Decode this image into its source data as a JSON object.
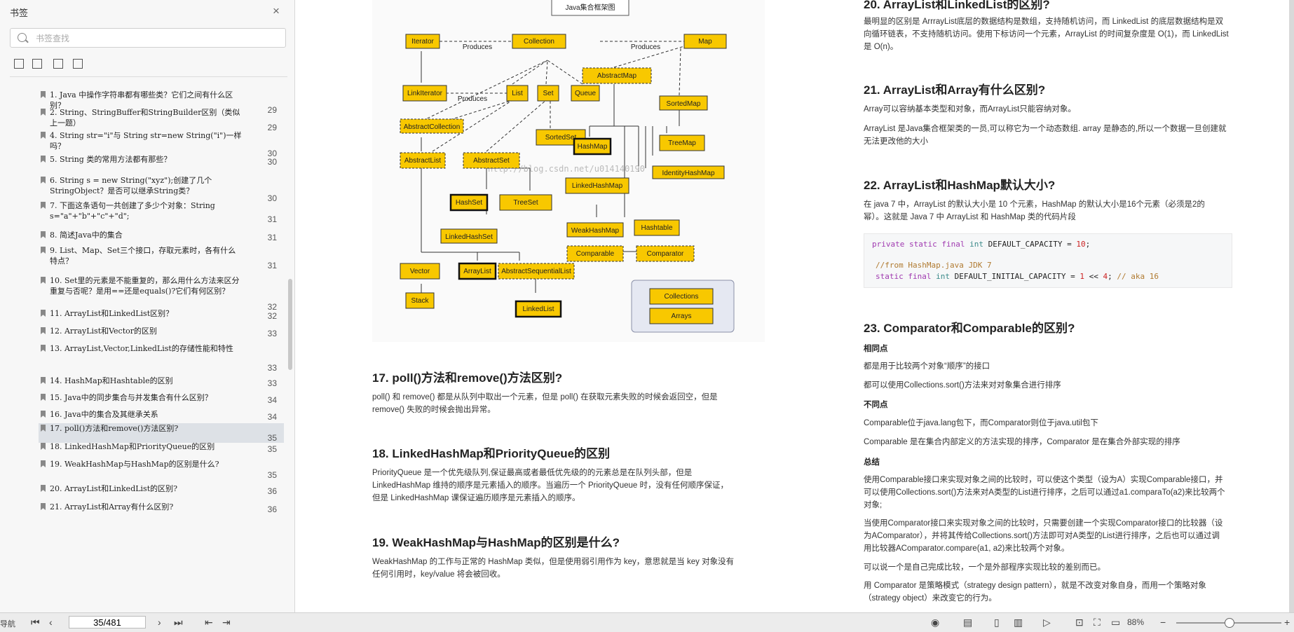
{
  "sidebar": {
    "title": "书签",
    "search_placeholder": "书签查找",
    "items": [
      {
        "text": "1. Java 中操作字符串都有哪些类？它们之间有什么区别？",
        "page": "29"
      },
      {
        "text": "2. String、StringBuffer和StringBuilder区别（类似上一题）",
        "page": "29"
      },
      {
        "text": "4. String str=\"i\"与 String str=new String(\"i\")一样吗？",
        "page": "30"
      },
      {
        "text": "5. String 类的常用方法都有那些？",
        "page": "30"
      },
      {
        "text": "6. String s = new String(\"xyz\");创建了几个StringObject？是否可以继承String类？",
        "page": "30"
      },
      {
        "text": "7. 下面这条语句一共创建了多少个对象：String s=\"a\"+\"b\"+\"c\"+\"d\";",
        "page": "31"
      },
      {
        "text": "8. 简述Java中的集合",
        "page": "31"
      },
      {
        "text": "9. List、Map、Set三个接口，存取元素时，各有什么特点？",
        "page": "31"
      },
      {
        "text": "10. Set里的元素是不能重复的，那么用什么方法来区分重复与否呢？是用==还是equals()?它们有何区别？",
        "page": "32"
      },
      {
        "text": "11. ArrayList和LinkedList区别？",
        "page": "32"
      },
      {
        "text": "12. ArrayList和Vector的区别",
        "page": "33"
      },
      {
        "text": "13. ArrayList,Vector,LinkedList的存储性能和特性",
        "page": "33"
      },
      {
        "text": "14. HashMap和Hashtable的区别",
        "page": "33"
      },
      {
        "text": "15. Java中的同步集合与并发集合有什么区别？",
        "page": "34"
      },
      {
        "text": "16. Java中的集合及其继承关系",
        "page": "34"
      },
      {
        "text": "17. poll()方法和remove()方法区别?",
        "page": "35"
      },
      {
        "text": "18. LinkedHashMap和PriorityQueue的区别",
        "page": "35"
      },
      {
        "text": "19. WeakHashMap与HashMap的区别是什么?",
        "page": "35"
      },
      {
        "text": "20. ArrayList和LinkedList的区别?",
        "page": "36"
      },
      {
        "text": "21. ArrayList和Array有什么区别?",
        "page": "36"
      }
    ]
  },
  "diagram": {
    "title": "Java集合框架图",
    "produces": "Produces",
    "watermark": "http://blog.csdn.net/u014140190",
    "nodes": {
      "iterator": "Iterator",
      "collection": "Collection",
      "map": "Map",
      "linkiterator": "LinkIterator",
      "list": "List",
      "set": "Set",
      "queue": "Queue",
      "abstractmap": "AbstractMap",
      "sortedmap": "SortedMap",
      "abstractcollection": "AbstractCollection",
      "sortedset": "SortedSet",
      "abstractlist": "AbstractList",
      "abstractset": "AbstractSet",
      "hashmap": "HashMap",
      "treemap": "TreeMap",
      "identityhashmap": "IdentityHashMap",
      "linkedhashmap": "LinkedHashMap",
      "hashset": "HashSet",
      "treeset": "TreeSet",
      "linkedhashset": "LinkedHashSet",
      "weakhashmap": "WeakHashMap",
      "hashtable": "Hashtable",
      "comparable": "Comparable",
      "comparator": "Comparator",
      "vector": "Vector",
      "arraylist": "ArrayList",
      "abstractsequentiallist": "AbstractSequentialList",
      "stack": "Stack",
      "linkedlist": "LinkedList",
      "collections": "Collections",
      "arrays": "Arrays"
    }
  },
  "left_col": {
    "h17": "17. poll()方法和remove()方法区别?",
    "p17": [
      "poll() 和 remove() 都是从队列中取出一个元素，但是 poll() 在获取元素失败的时候会返回空，但是",
      "remove() 失败的时候会抛出异常。"
    ],
    "h18": "18. LinkedHashMap和PriorityQueue的区别",
    "p18": [
      "PriorityQueue 是一个优先级队列,保证最高或者最低优先级的的元素总是在队列头部，但是",
      "LinkedHashMap 维持的顺序是元素插入的顺序。当遍历一个 PriorityQueue 时，没有任何顺序保证，",
      "但是 LinkedHashMap 课保证遍历顺序是元素插入的顺序。"
    ],
    "h19": "19. WeakHashMap与HashMap的区别是什么?",
    "p19": [
      "WeakHashMap 的工作与正常的 HashMap 类似，但是使用弱引用作为 key，意思就是当 key 对象没有",
      "任何引用时，key/value 将会被回收。"
    ]
  },
  "right_col": {
    "h20": "20. ArrayList和LinkedList的区别?",
    "p20": [
      "最明显的区别是 ArrrayList底层的数据结构是数组，支持随机访问，而 LinkedList 的底层数据结构是双",
      "向循环链表，不支持随机访问。使用下标访问一个元素，ArrayList 的时间复杂度是 O(1)，而 LinkedList",
      "是 O(n)。"
    ],
    "h21": "21. ArrayList和Array有什么区别?",
    "p21a": "Array可以容纳基本类型和对象，而ArrayList只能容纳对象。",
    "p21b": [
      "ArrayList 是Java集合框架类的一员,可以称它为一个动态数组. array 是静态的,所以一个数据一旦创建就",
      "无法更改他的大小"
    ],
    "h22": "22. ArrayList和HashMap默认大小?",
    "p22": [
      "在 java 7 中，ArrayList 的默认大小是 10 个元素，HashMap 的默认大小是16个元素（必须是2的",
      "幂）。这就是 Java 7 中 ArrayList 和 HashMap 类的代码片段"
    ],
    "code": {
      "l1": {
        "kw": "private static final ",
        "ty": "int ",
        "id": "DEFAULT_CAPACITY = ",
        "num": "10",
        "end": ";"
      },
      "l2": {
        "cm": "//from HashMap.java JDK 7"
      },
      "l3": {
        "kw": "static final ",
        "ty": "int ",
        "id": "DEFAULT_INITIAL_CAPACITY = ",
        "num1": "1",
        "op": " << ",
        "num2": "4",
        "end": "; ",
        "cm": "// aka 16"
      }
    },
    "h23": "23. Comparator和Comparable的区别?",
    "same_title": "相同点",
    "same": [
      "都是用于比较两个对象“顺序”的接口",
      "都可以使用Collections.sort()方法来对对象集合进行排序"
    ],
    "diff_title": "不同点",
    "diff": [
      "Comparable位于java.lang包下，而Comparator则位于java.util包下",
      "Comparable 是在集合内部定义的方法实现的排序，Comparator 是在集合外部实现的排序"
    ],
    "sum_title": "总结",
    "sum1": [
      "使用Comparable接口来实现对象之间的比较时，可以使这个类型（设为A）实现Comparable接口，并",
      "可以使用Collections.sort()方法来对A类型的List进行排序，之后可以通过a1.comparaTo(a2)来比较两个",
      "对象;"
    ],
    "sum2": [
      "当使用Comparator接口来实现对象之间的比较时，只需要创建一个实现Comparator接口的比较器（设",
      "为AComparator），并将其传给Collections.sort()方法即可对A类型的List进行排序，之后也可以通过调",
      "用比较器AComparator.compare(a1, a2)来比较两个对象。"
    ],
    "sum3": "可以说一个是自己完成比较，一个是外部程序实现比较的差别而已。",
    "sum4": [
      "用 Comparator 是策略模式（strategy design pattern），就是不改变对象自身，而用一个策略对象",
      "（strategy object）来改变它的行为。"
    ]
  },
  "statusbar": {
    "left_label": "导航",
    "page_value": "35/481",
    "zoom": "88%",
    "zoom_level": 0.5
  }
}
